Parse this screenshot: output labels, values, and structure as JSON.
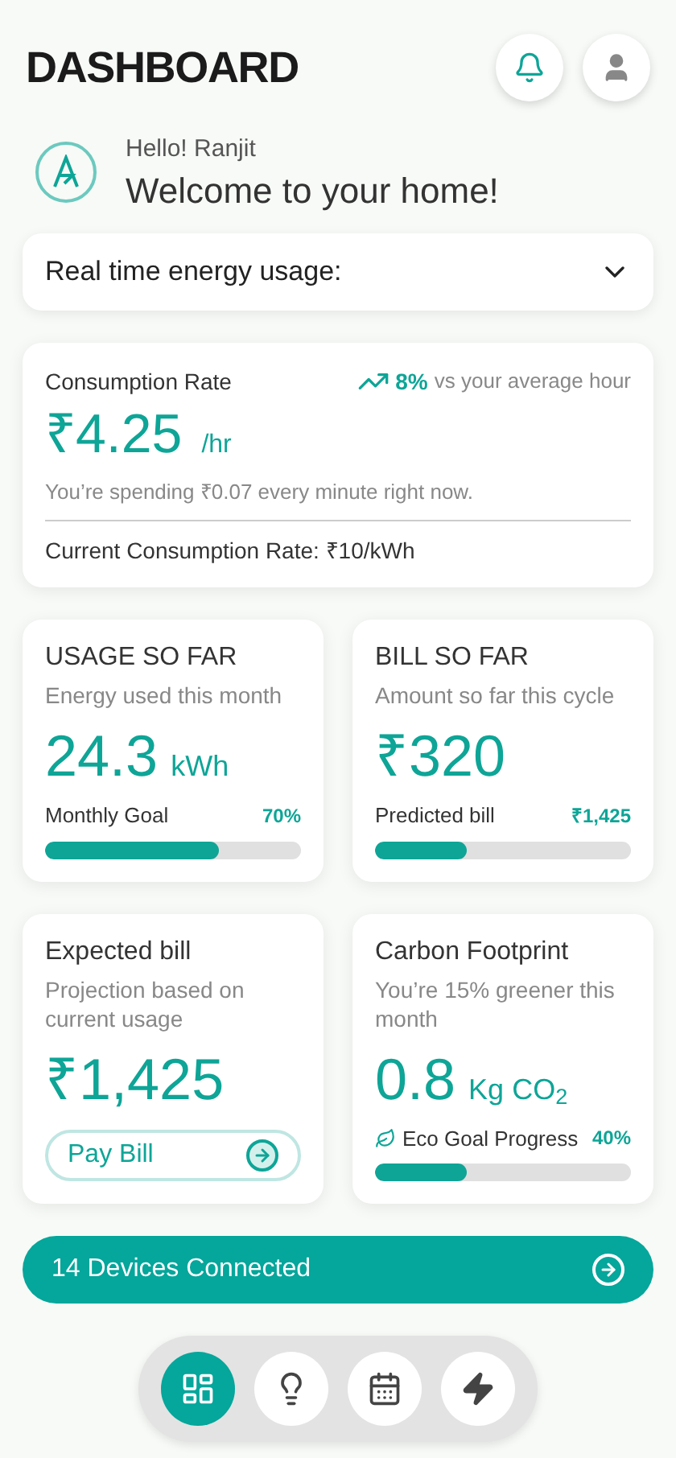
{
  "header": {
    "title": "DASHBOARD"
  },
  "greeting": {
    "hello": "Hello! Ranjit",
    "welcome": "Welcome to your home!"
  },
  "dropdown": {
    "label": "Real time energy usage:"
  },
  "consumption": {
    "title": "Consumption Rate",
    "trend": "8%",
    "trend_text": "vs your average hour",
    "value": "₹4.25",
    "unit": "/hr",
    "note": "You’re spending ₹0.07 every minute right now.",
    "rate": "Current Consumption Rate: ₹10/kWh"
  },
  "cards": [
    {
      "kind": "progress",
      "title": "USAGE SO FAR",
      "subtitle": "Energy used this month",
      "value": "24.3",
      "unit": "kWh",
      "bar_label": "Monthly Goal",
      "bar_value": "70%",
      "level": 0.68,
      "leaf": false
    },
    {
      "kind": "progress",
      "title": "BILL SO FAR",
      "subtitle": "Amount so far this cycle",
      "value": "₹320",
      "bar_label": "Predicted bill",
      "bar_value": "₹1,425",
      "level": 0.36,
      "leaf": false
    },
    {
      "kind": "action",
      "title": "Expected bill",
      "subtitle": "Projection based on current usage",
      "value": "₹1,425",
      "button": "Pay Bill"
    },
    {
      "kind": "progress",
      "title": "Carbon Footprint",
      "subtitle": "You’re 15% greener this month",
      "value": "0.8",
      "unit": "Kg CO$_{2}$",
      "bar_label": "Eco Goal Progress",
      "bar_value": "40%",
      "level": 0.36,
      "leaf": true
    }
  ],
  "devices": {
    "label": "14 Devices Connected"
  },
  "nav": [
    {
      "kind": "grid",
      "selected": true
    },
    {
      "kind": "bulb",
      "selected": false
    },
    {
      "kind": "calendar",
      "selected": false
    },
    {
      "kind": "bolt",
      "selected": false
    }
  ]
}
